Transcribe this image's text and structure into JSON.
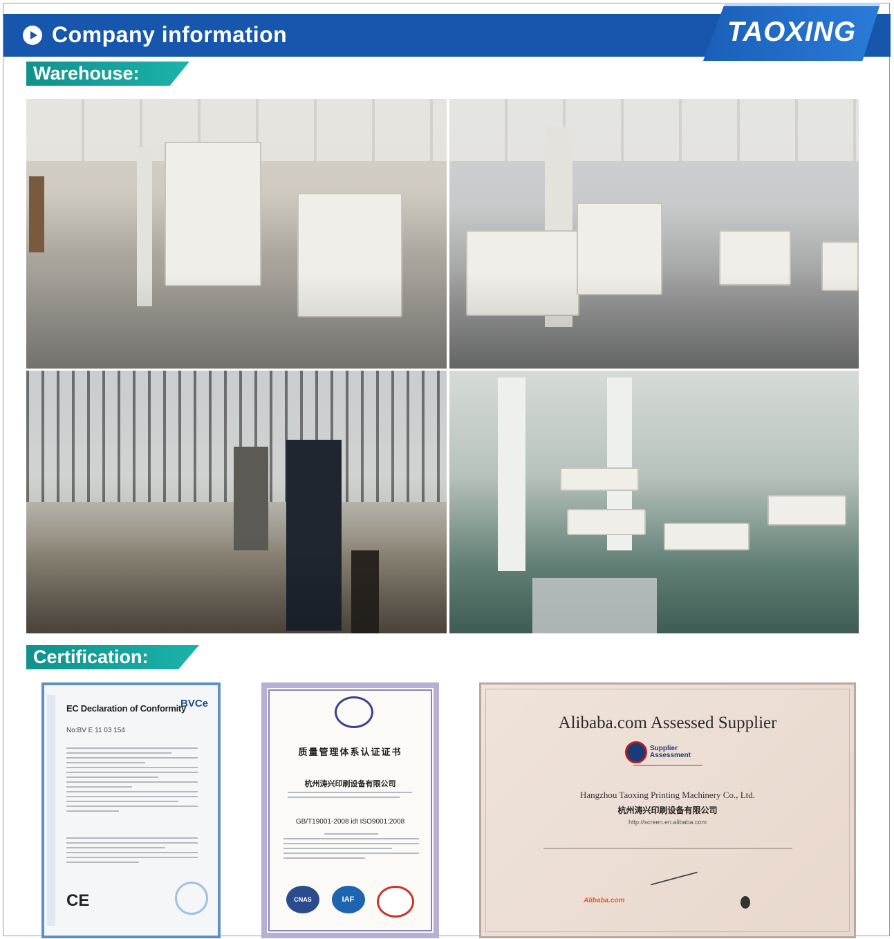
{
  "header": {
    "title": "Company information",
    "logo_text": "TAOXING",
    "accent_color": "#1756ad",
    "play_icon": "play-circle-icon"
  },
  "sections": {
    "warehouse_label": "Warehouse:",
    "certification_label": "Certification:",
    "tag_color": "#16a39c"
  },
  "certificates": {
    "ec": {
      "heading": "EC Declaration of Conformity",
      "brand": "BVCe",
      "number": "No:BV E 11 03 154",
      "mark": "CE"
    },
    "iso": {
      "title_cn": "质量管理体系认证证书",
      "company_cn": "杭州涛兴印刷设备有限公司",
      "standard": "GB/T19001-2008 idt ISO9001:2008",
      "logos": [
        "CNAS",
        "IAF"
      ]
    },
    "alibaba": {
      "title": "Alibaba.com Assessed Supplier",
      "badge_line1": "Supplier",
      "badge_line2": "Assessment",
      "company": "Hangzhou Taoxing Printing Machinery Co., Ltd.",
      "company_cn": "杭州涛兴印刷设备有限公司",
      "url": "http://screen.en.alibaba.com",
      "logo": "Alibaba.com"
    }
  }
}
